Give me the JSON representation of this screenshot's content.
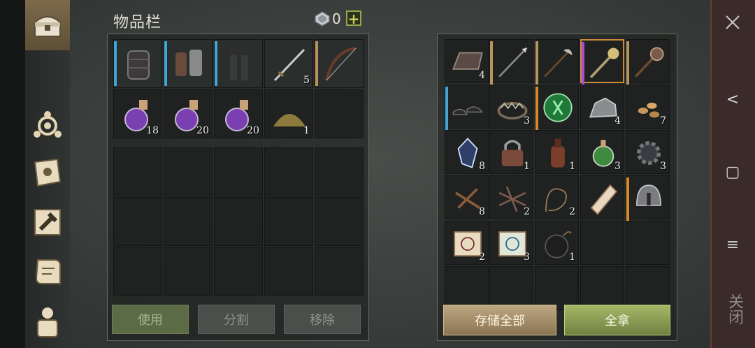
{
  "inventory": {
    "title": "物品栏",
    "gem_count": "0",
    "add_label": "+",
    "equip_row": [
      {
        "name": "chest-armor-icon",
        "bar": "#3fa6d6",
        "count": ""
      },
      {
        "name": "gloves-icon",
        "bar": "#3fa6d6",
        "count": ""
      },
      {
        "name": "leg-armor-icon",
        "bar": "#3fa6d6",
        "count": ""
      },
      {
        "name": "sword-icon",
        "bar": "",
        "count": "5"
      },
      {
        "name": "bow-icon",
        "bar": "#b8945c",
        "count": ""
      }
    ],
    "consumable_row": [
      {
        "name": "purple-potion-icon",
        "count": "18"
      },
      {
        "name": "purple-potion-icon",
        "count": "20"
      },
      {
        "name": "purple-potion-icon",
        "count": "20"
      },
      {
        "name": "powder-pile-icon",
        "count": "1"
      },
      {
        "name": "empty-slot",
        "count": ""
      }
    ],
    "buttons": {
      "use": "使用",
      "split": "分割",
      "remove": "移除"
    }
  },
  "loot": {
    "rows": [
      [
        {
          "name": "metal-ingot-icon",
          "count": "4"
        },
        {
          "name": "spear-icon",
          "count": ""
        },
        {
          "name": "halberd-icon",
          "count": ""
        },
        {
          "name": "mace-icon",
          "count": ""
        },
        {
          "name": "morning-star-icon",
          "count": ""
        }
      ],
      [
        {
          "name": "shoes-icon",
          "count": ""
        },
        {
          "name": "bear-trap-icon",
          "count": "3"
        },
        {
          "name": "green-rune-icon",
          "count": ""
        },
        {
          "name": "stone-ore-icon",
          "count": "4"
        },
        {
          "name": "seeds-icon",
          "count": "7"
        }
      ],
      [
        {
          "name": "crystal-icon",
          "count": "8"
        },
        {
          "name": "padlock-icon",
          "count": "1"
        },
        {
          "name": "bottle-icon",
          "count": "1"
        },
        {
          "name": "green-flask-icon",
          "count": "3"
        },
        {
          "name": "gear-icon",
          "count": "3"
        }
      ],
      [
        {
          "name": "nails-icon",
          "count": "8"
        },
        {
          "name": "sticks-icon",
          "count": "2"
        },
        {
          "name": "rope-icon",
          "count": "2"
        },
        {
          "name": "scroll-roll-icon",
          "count": ""
        },
        {
          "name": "helmet-icon",
          "count": ""
        }
      ],
      [
        {
          "name": "red-scroll-icon",
          "count": "2"
        },
        {
          "name": "blue-scroll-icon",
          "count": "3"
        },
        {
          "name": "bomb-icon",
          "count": "1"
        },
        {
          "name": "empty-slot",
          "count": ""
        },
        {
          "name": "empty-slot",
          "count": ""
        }
      ]
    ],
    "buttons": {
      "store_all": "存储全部",
      "take_all": "全拿"
    }
  },
  "system": {
    "back": "<",
    "home": "▢",
    "menu": "≡",
    "close_vertical": "关闭"
  },
  "colors": {
    "blue_tier": "#3fa6d6",
    "purple_tier": "#a84cd6",
    "orange_tier": "#d68a2c",
    "tan_tier": "#b8945c"
  }
}
